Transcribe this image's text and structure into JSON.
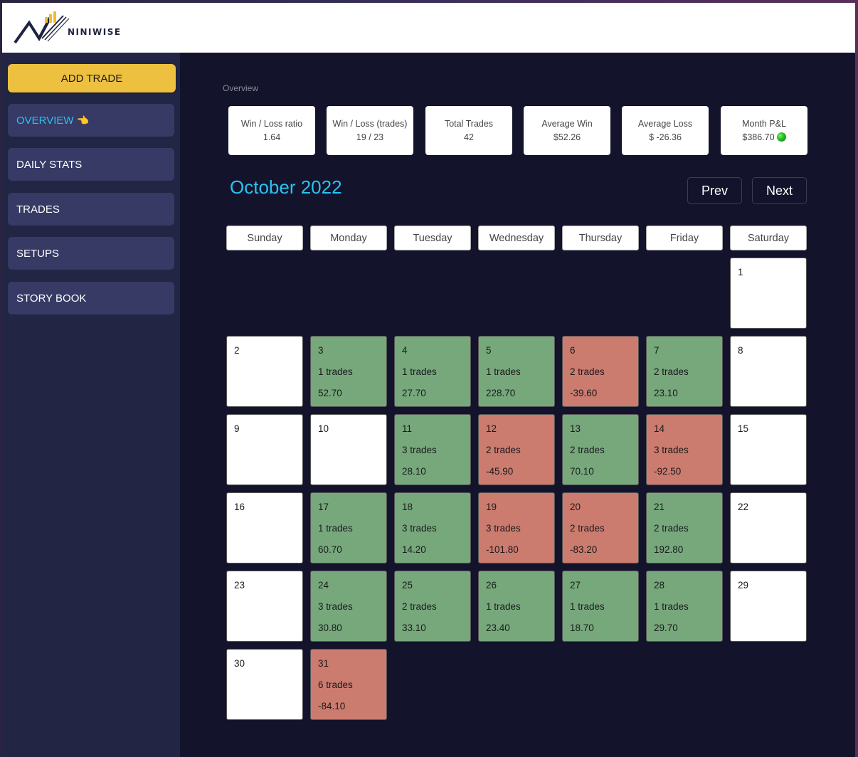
{
  "brand": {
    "name": "NINIWISE"
  },
  "sidebar": {
    "add_trade_label": "ADD TRADE",
    "items": [
      {
        "label": "OVERVIEW",
        "icon": "pointing-hand-icon",
        "active": true
      },
      {
        "label": "DAILY STATS"
      },
      {
        "label": "TRADES"
      },
      {
        "label": "SETUPS"
      },
      {
        "label": "STORY BOOK"
      }
    ]
  },
  "main": {
    "section_label": "Overview",
    "stats": [
      {
        "title": "Win / Loss ratio",
        "value": "1.64"
      },
      {
        "title": "Win / Loss (trades)",
        "value": "19 / 23"
      },
      {
        "title": "Total Trades",
        "value": "42"
      },
      {
        "title": "Average Win",
        "value": "$52.26"
      },
      {
        "title": "Average Loss",
        "value": "$ -26.36"
      },
      {
        "title": "Month P&L",
        "value": "$386.70"
      }
    ],
    "calendar": {
      "title": "October 2022",
      "prev_label": "Prev",
      "next_label": "Next",
      "weekdays": [
        "Sunday",
        "Monday",
        "Tuesday",
        "Wednesday",
        "Thursday",
        "Friday",
        "Saturday"
      ],
      "first_weekday_index": 6,
      "days": [
        {
          "day": "1"
        },
        {
          "day": "2"
        },
        {
          "day": "3",
          "trades": "1 trades",
          "pnl": "52.70",
          "result": "win"
        },
        {
          "day": "4",
          "trades": "1 trades",
          "pnl": "27.70",
          "result": "win"
        },
        {
          "day": "5",
          "trades": "1 trades",
          "pnl": "228.70",
          "result": "win"
        },
        {
          "day": "6",
          "trades": "2 trades",
          "pnl": "-39.60",
          "result": "loss"
        },
        {
          "day": "7",
          "trades": "2 trades",
          "pnl": "23.10",
          "result": "win"
        },
        {
          "day": "8"
        },
        {
          "day": "9"
        },
        {
          "day": "10"
        },
        {
          "day": "11",
          "trades": "3 trades",
          "pnl": "28.10",
          "result": "win"
        },
        {
          "day": "12",
          "trades": "2 trades",
          "pnl": "-45.90",
          "result": "loss"
        },
        {
          "day": "13",
          "trades": "2 trades",
          "pnl": "70.10",
          "result": "win"
        },
        {
          "day": "14",
          "trades": "3 trades",
          "pnl": "-92.50",
          "result": "loss"
        },
        {
          "day": "15"
        },
        {
          "day": "16"
        },
        {
          "day": "17",
          "trades": "1 trades",
          "pnl": "60.70",
          "result": "win"
        },
        {
          "day": "18",
          "trades": "3 trades",
          "pnl": "14.20",
          "result": "win"
        },
        {
          "day": "19",
          "trades": "3 trades",
          "pnl": "-101.80",
          "result": "loss"
        },
        {
          "day": "20",
          "trades": "2 trades",
          "pnl": "-83.20",
          "result": "loss"
        },
        {
          "day": "21",
          "trades": "2 trades",
          "pnl": "192.80",
          "result": "win"
        },
        {
          "day": "22"
        },
        {
          "day": "23"
        },
        {
          "day": "24",
          "trades": "3 trades",
          "pnl": "30.80",
          "result": "win"
        },
        {
          "day": "25",
          "trades": "2 trades",
          "pnl": "33.10",
          "result": "win"
        },
        {
          "day": "26",
          "trades": "1 trades",
          "pnl": "23.40",
          "result": "win"
        },
        {
          "day": "27",
          "trades": "1 trades",
          "pnl": "18.70",
          "result": "win"
        },
        {
          "day": "28",
          "trades": "1 trades",
          "pnl": "29.70",
          "result": "win"
        },
        {
          "day": "29"
        },
        {
          "day": "30"
        },
        {
          "day": "31",
          "trades": "6 trades",
          "pnl": "-84.10",
          "result": "loss"
        }
      ]
    }
  },
  "colors": {
    "accent": "#29c3f2",
    "add_trade": "#edc03f",
    "win": "#76a87c",
    "loss": "#cc7b6f",
    "background": "#13132b",
    "sidebar": "#222544",
    "nav_item": "#363a64"
  }
}
